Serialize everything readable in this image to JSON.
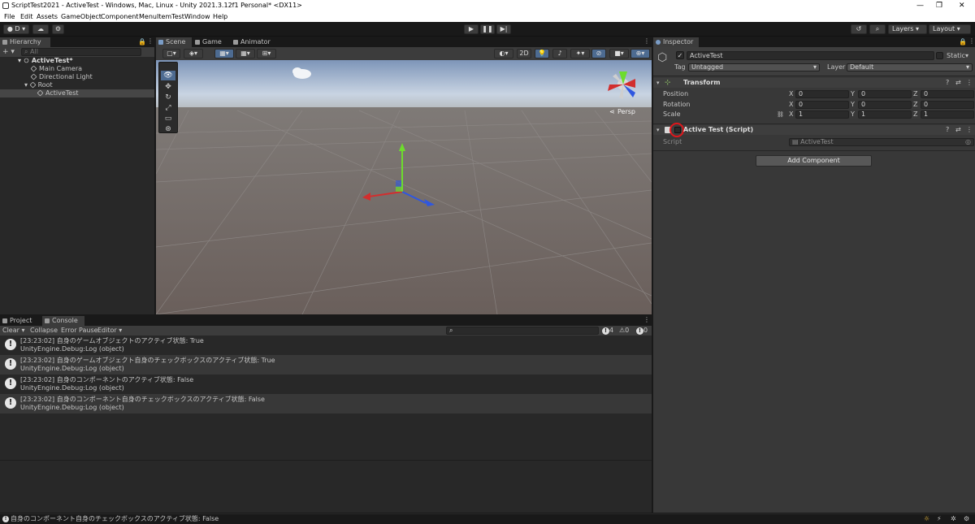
{
  "window": {
    "title": "ScriptTest2021 - ActiveTest - Windows, Mac, Linux - Unity 2021.3.12f1 Personal* <DX11>",
    "controls": [
      "—",
      "❐",
      "✕"
    ]
  },
  "menu": [
    "File",
    "Edit",
    "Assets",
    "GameObject",
    "Component",
    "MenuItemTest",
    "Window",
    "Help"
  ],
  "toolbar": {
    "account": "D",
    "layers": "Layers",
    "layout": "Layout"
  },
  "hierarchy": {
    "tab": "Hierarchy",
    "search_placeholder": "All",
    "items": [
      {
        "label": "ActiveTest*"
      },
      {
        "label": "Main Camera"
      },
      {
        "label": "Directional Light"
      },
      {
        "label": "Root"
      },
      {
        "label": "ActiveTest"
      }
    ]
  },
  "scene": {
    "tabs": [
      "Scene",
      "Game",
      "Animator"
    ],
    "mode_2d": "2D",
    "persp": "Persp"
  },
  "inspector": {
    "tab": "Inspector",
    "object_name": "ActiveTest",
    "static_label": "Static",
    "tag_label": "Tag",
    "tag_value": "Untagged",
    "layer_label": "Layer",
    "layer_value": "Default",
    "transform": {
      "title": "Transform",
      "rows": [
        {
          "label": "Position",
          "x": "0",
          "y": "0",
          "z": "0"
        },
        {
          "label": "Rotation",
          "x": "0",
          "y": "0",
          "z": "0"
        },
        {
          "label": "Scale",
          "x": "1",
          "y": "1",
          "z": "1"
        }
      ],
      "axis": [
        "X",
        "Y",
        "Z"
      ]
    },
    "script_component": {
      "title": "Active Test (Script)",
      "script_label": "Script",
      "script_value": "ActiveTest"
    },
    "add_component": "Add Component"
  },
  "console": {
    "tabs": [
      "Project",
      "Console"
    ],
    "toolbar": {
      "clear": "Clear",
      "collapse": "Collapse",
      "error_pause": "Error Pause",
      "editor": "Editor"
    },
    "counts": {
      "log": "4",
      "warn": "0",
      "error": "0"
    },
    "entries": [
      {
        "line1": "[23:23:02] 自身のゲームオブジェクトのアクティブ状態: True",
        "line2": "UnityEngine.Debug:Log (object)"
      },
      {
        "line1": "[23:23:02] 自身のゲームオブジェクト自身のチェックボックスのアクティブ状態: True",
        "line2": "UnityEngine.Debug:Log (object)"
      },
      {
        "line1": "[23:23:02] 自身のコンポーネントのアクティブ状態: False",
        "line2": "UnityEngine.Debug:Log (object)"
      },
      {
        "line1": "[23:23:02] 自身のコンポーネント自身のチェックボックスのアクティブ状態: False",
        "line2": "UnityEngine.Debug:Log (object)"
      }
    ]
  },
  "statusbar": {
    "message": "自身のコンポーネント自身のチェックボックスのアクティブ状態: False"
  },
  "colors": {
    "accent": "#3a79bb",
    "highlight_circle": "#e0161b",
    "panel": "#282828"
  }
}
